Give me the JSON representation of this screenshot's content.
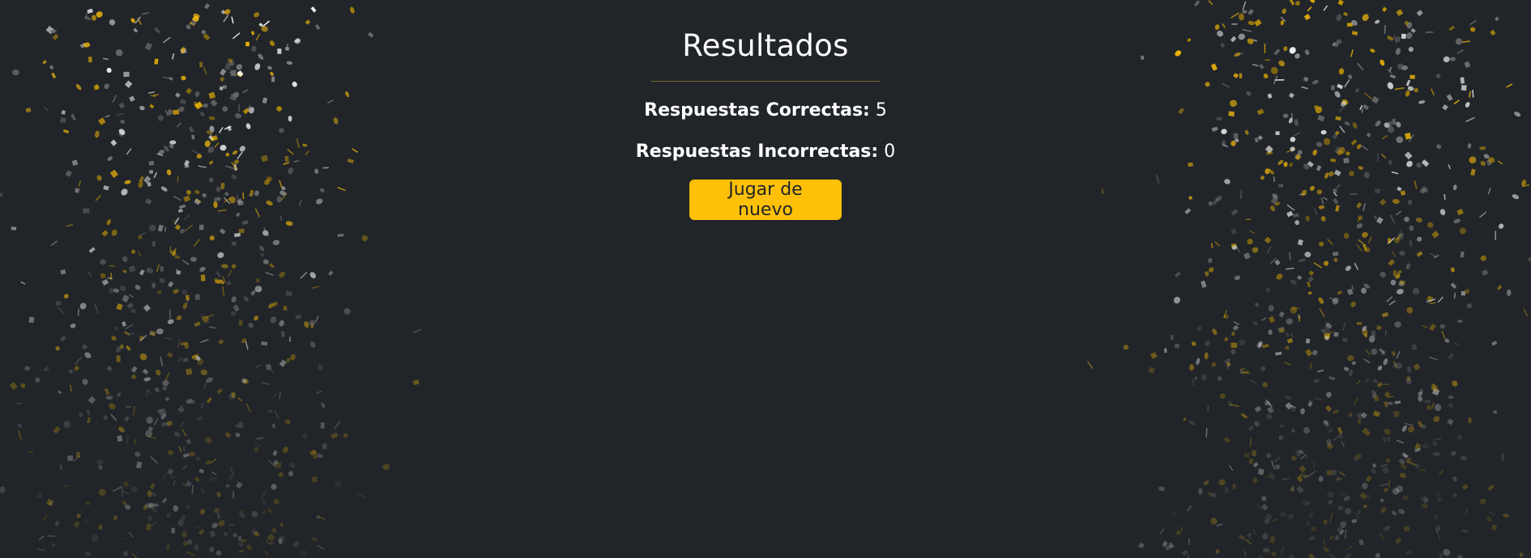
{
  "results": {
    "title": "Resultados",
    "correct_label": "Respuestas Correctas:",
    "correct_value": "5",
    "incorrect_label": "Respuestas Incorrectas:",
    "incorrect_value": "0",
    "replay_button_label": "Jugar de nuevo"
  },
  "colors": {
    "background": "#212529",
    "accent": "#ffc107",
    "divider": "#7a6a2a",
    "text": "#ffffff",
    "confetti": [
      "#ffc107",
      "#ffffff",
      "#9e9e9e",
      "#c99a06",
      "#6c6c6c"
    ]
  }
}
